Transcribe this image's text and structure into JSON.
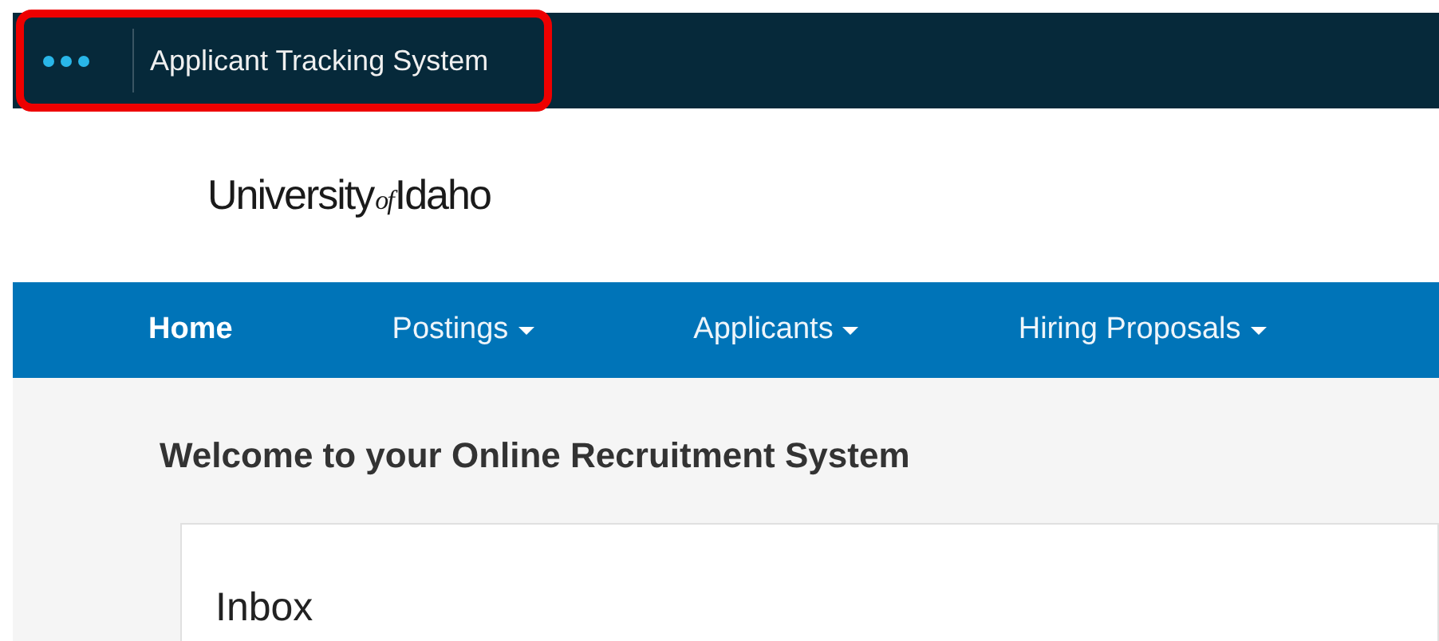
{
  "app_bar": {
    "title": "Applicant Tracking System",
    "highlighted": true
  },
  "logo": {
    "main": "University",
    "small": "of",
    "end": "Idaho"
  },
  "nav": [
    {
      "label": "Home",
      "selected": true,
      "has_menu": false
    },
    {
      "label": "Postings",
      "selected": false,
      "has_menu": true
    },
    {
      "label": "Applicants",
      "selected": false,
      "has_menu": true
    },
    {
      "label": "Hiring Proposals",
      "selected": false,
      "has_menu": true
    }
  ],
  "heading": "Welcome to your Online Recruitment System",
  "inbox": {
    "title": "Inbox"
  }
}
